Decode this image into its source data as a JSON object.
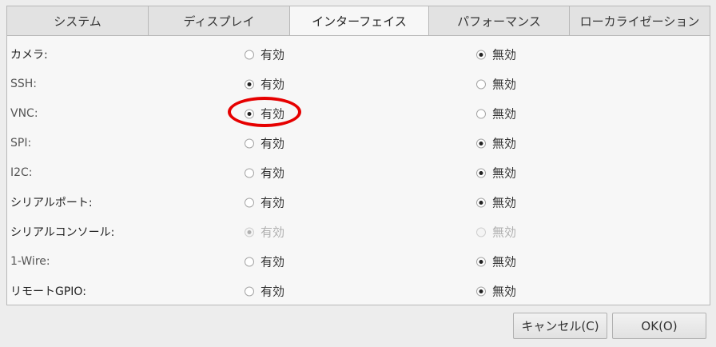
{
  "tabs": [
    {
      "label": "システム"
    },
    {
      "label": "ディスプレイ"
    },
    {
      "label": "インターフェイス"
    },
    {
      "label": "パフォーマンス"
    },
    {
      "label": "ローカライゼーション"
    }
  ],
  "active_tab": "インターフェイス",
  "options": {
    "enable": "有効",
    "disable": "無効"
  },
  "rows": [
    {
      "label": "カメラ:",
      "selected": "disable",
      "disabled": false
    },
    {
      "label": "SSH:",
      "selected": "enable",
      "disabled": false
    },
    {
      "label": "VNC:",
      "selected": "enable",
      "disabled": false
    },
    {
      "label": "SPI:",
      "selected": "disable",
      "disabled": false
    },
    {
      "label": "I2C:",
      "selected": "disable",
      "disabled": false
    },
    {
      "label": "シリアルポート:",
      "selected": "disable",
      "disabled": false
    },
    {
      "label": "シリアルコンソール:",
      "selected": "enable",
      "disabled": true
    },
    {
      "label": "1-Wire:",
      "selected": "disable",
      "disabled": false
    },
    {
      "label": "リモートGPIO:",
      "selected": "disable",
      "disabled": false
    }
  ],
  "buttons": {
    "cancel": "キャンセル(C)",
    "ok": "OK(O)"
  },
  "colors": {
    "highlight": "#e60000",
    "tab_active_bg": "#f7f7f7"
  }
}
